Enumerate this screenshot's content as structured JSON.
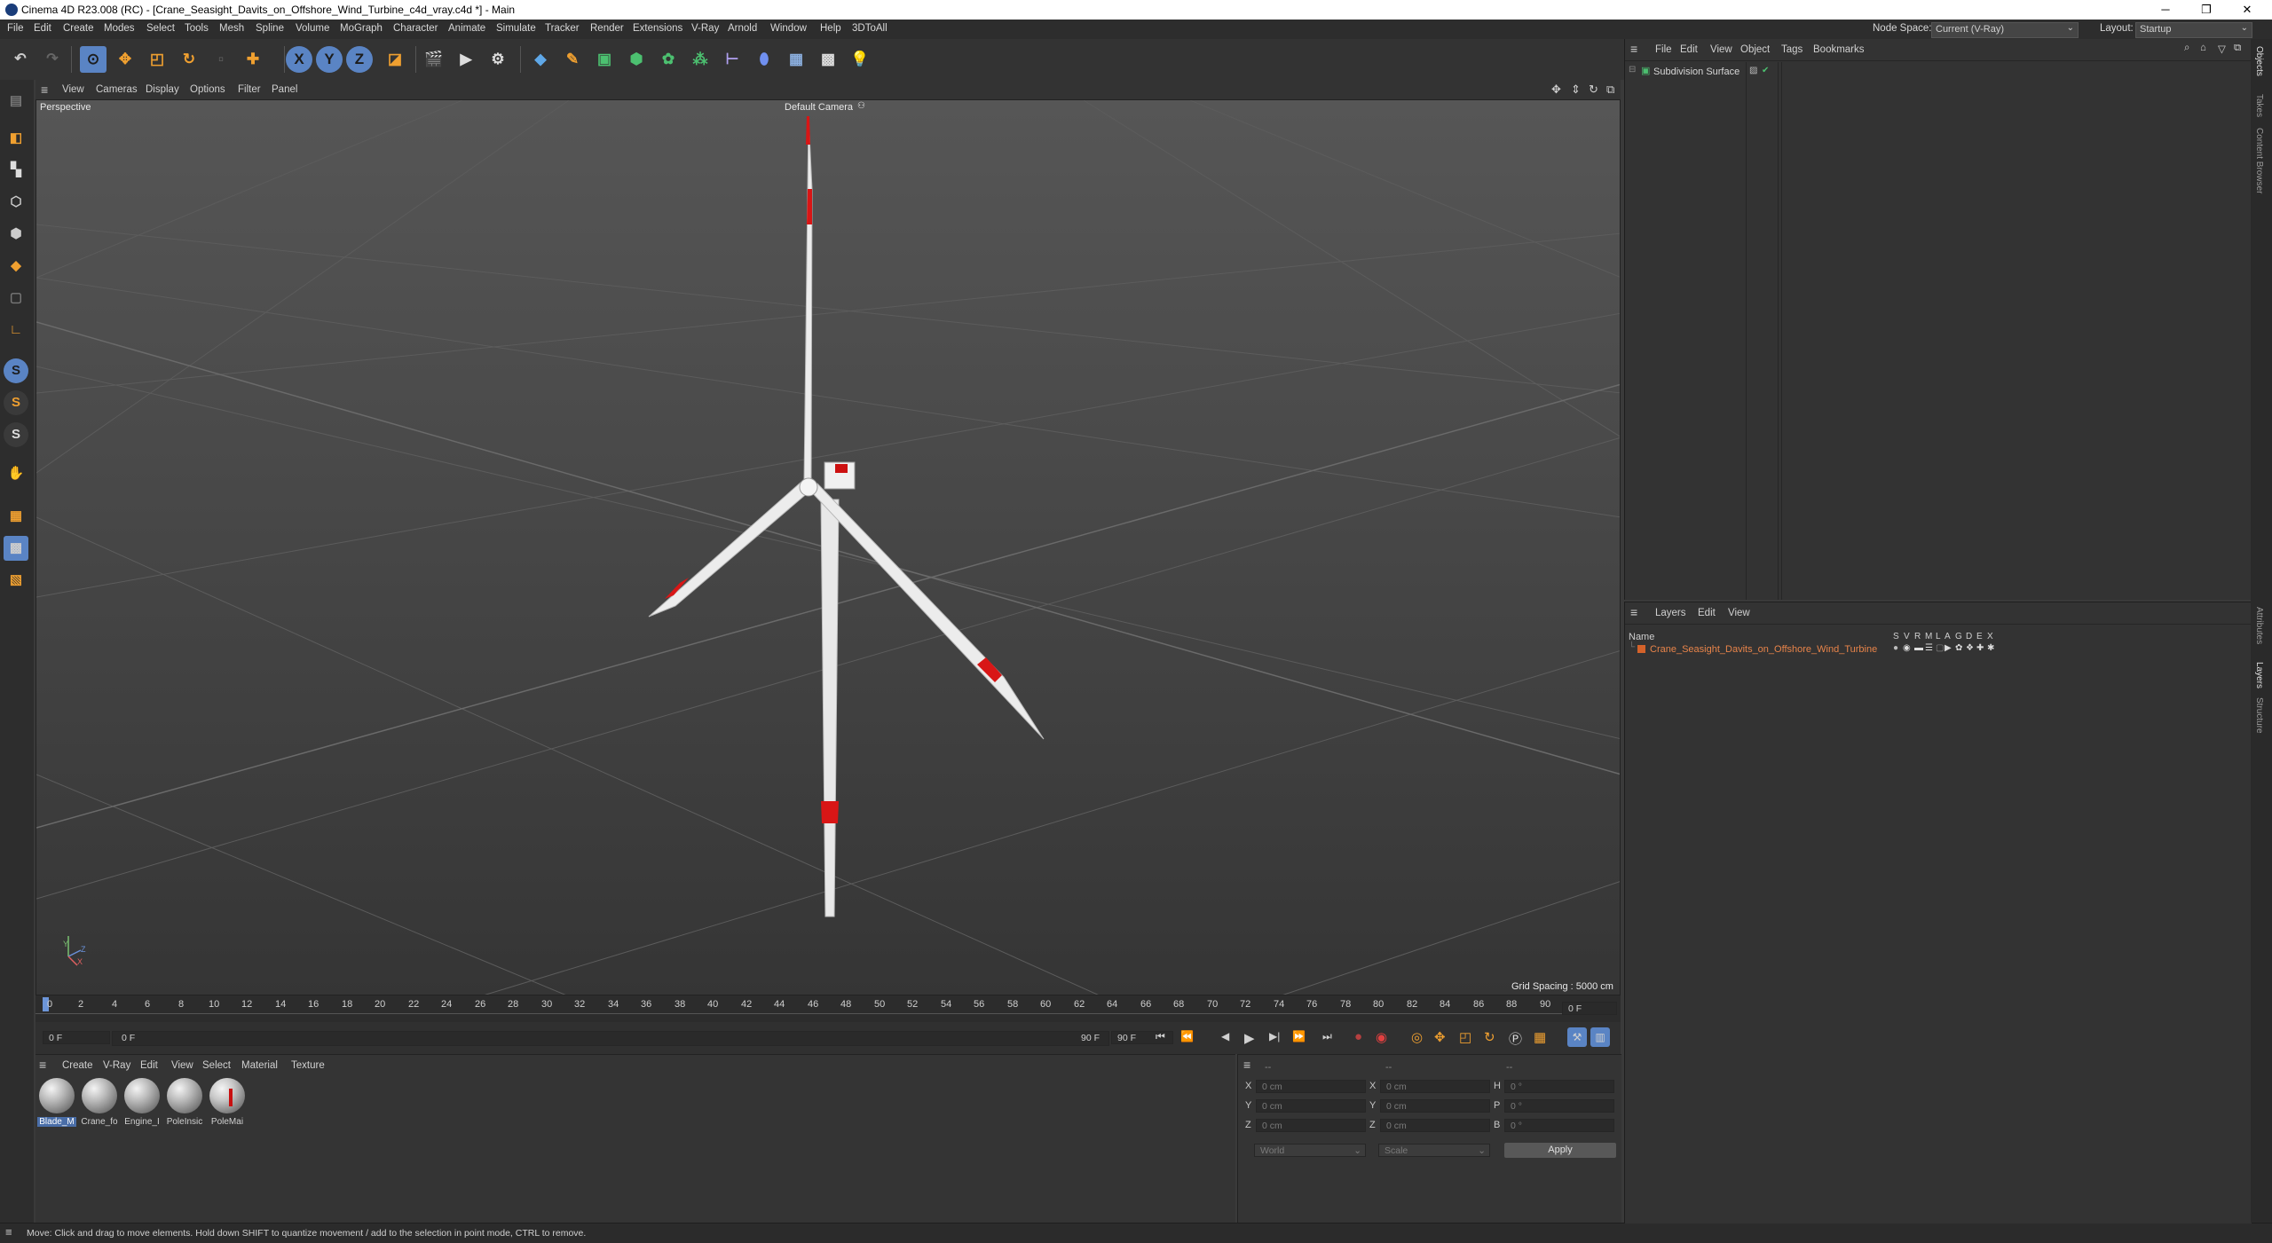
{
  "window": {
    "title": "Cinema 4D R23.008 (RC) - [Crane_Seasight_Davits_on_Offshore_Wind_Turbine_c4d_vray.c4d *] - Main",
    "min_glyph": "─",
    "max_glyph": "❐",
    "close_glyph": "✕"
  },
  "menubar": {
    "items": [
      "File",
      "Edit",
      "Create",
      "Modes",
      "Select",
      "Tools",
      "Mesh",
      "Spline",
      "Volume",
      "MoGraph",
      "Character",
      "Animate",
      "Simulate",
      "Tracker",
      "Render",
      "Extensions",
      "V-Ray",
      "Arnold",
      "Window",
      "Help",
      "3DToAll"
    ],
    "node_space_label": "Node Space:",
    "node_space_value": "Current (V-Ray)",
    "layout_label": "Layout:",
    "layout_value": "Startup"
  },
  "toolbar": {
    "axis_x": "X",
    "axis_y": "Y",
    "axis_z": "Z"
  },
  "lefttools": {
    "s1": "S",
    "s2": "S",
    "s3": "S"
  },
  "viewport": {
    "menu": [
      "View",
      "Cameras",
      "Display",
      "Options",
      "Filter",
      "Panel"
    ],
    "label": "Perspective",
    "camera": "Default Camera",
    "grid_spacing": "Grid Spacing : 5000 cm",
    "axis_y": "Y",
    "axis_z": "Z",
    "axis_x": "X"
  },
  "timeline": {
    "ticks": [
      "0",
      "2",
      "4",
      "6",
      "8",
      "10",
      "12",
      "14",
      "16",
      "18",
      "20",
      "22",
      "24",
      "26",
      "28",
      "30",
      "32",
      "34",
      "36",
      "38",
      "40",
      "42",
      "44",
      "46",
      "48",
      "50",
      "52",
      "54",
      "56",
      "58",
      "60",
      "62",
      "64",
      "66",
      "68",
      "70",
      "72",
      "74",
      "76",
      "78",
      "80",
      "82",
      "84",
      "86",
      "88",
      "90"
    ],
    "frame_field": "0 F",
    "start_field": "0 F",
    "range_start": "0 F",
    "range_end": "90 F",
    "end_field": "90 F"
  },
  "materials": {
    "menu": [
      "Create",
      "V-Ray",
      "Edit",
      "View",
      "Select",
      "Material",
      "Texture"
    ],
    "items": [
      "Blade_M",
      "Crane_fo",
      "Engine_I",
      "PoleInsic",
      "PoleMai"
    ]
  },
  "coords": {
    "header_a": "--",
    "header_b": "--",
    "header_c": "--",
    "x": "X",
    "y": "Y",
    "z": "Z",
    "h": "H",
    "p": "P",
    "b": "B",
    "pos_x": "0 cm",
    "pos_y": "0 cm",
    "pos_z": "0 cm",
    "size_x": "0 cm",
    "size_y": "0 cm",
    "size_z": "0 cm",
    "rot_h": "0 °",
    "rot_p": "0 °",
    "rot_b": "0 °",
    "mode1": "World",
    "mode2": "Scale",
    "apply": "Apply"
  },
  "objects": {
    "menu": [
      "File",
      "Edit",
      "View",
      "Object",
      "Tags",
      "Bookmarks"
    ],
    "item": "Subdivision Surface"
  },
  "layers": {
    "menu": [
      "Layers",
      "Edit",
      "View"
    ],
    "name_header": "Name",
    "flags": [
      "S",
      "V",
      "R",
      "M",
      "L",
      "A",
      "G",
      "D",
      "E",
      "X"
    ],
    "item": "Crane_Seasight_Davits_on_Offshore_Wind_Turbine",
    "item_color": "#d4622a"
  },
  "sidetabs": [
    "Objects",
    "Takes",
    "Content Browser",
    "Attributes",
    "Layers",
    "Structure"
  ],
  "status": "Move: Click and drag to move elements. Hold down SHIFT to quantize movement / add to the selection in point mode, CTRL to remove.",
  "colors": {
    "accent": "#5a84c4",
    "brand_red": "#c81010"
  }
}
